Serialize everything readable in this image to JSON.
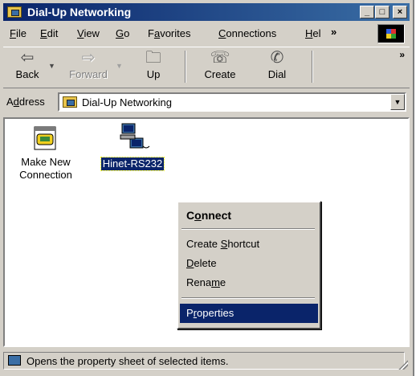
{
  "window": {
    "title": "Dial-Up Networking",
    "controls": {
      "minimize": "_",
      "maximize": "□",
      "close": "×"
    }
  },
  "menu": {
    "items": [
      {
        "label": "File",
        "key": "F",
        "rest": "ile"
      },
      {
        "label": "Edit",
        "key": "E",
        "rest": "dit"
      },
      {
        "label": "View",
        "key": "V",
        "rest": "iew"
      },
      {
        "label": "Go",
        "key": "G",
        "rest": "o"
      },
      {
        "label": "Favorites",
        "pre": "F",
        "key": "a",
        "rest": "vorites"
      },
      {
        "label": "Connections",
        "key": "C",
        "rest": "onnections"
      },
      {
        "label": "Hel",
        "key": "H",
        "rest": "el"
      }
    ],
    "overflow": "»"
  },
  "toolbar": {
    "back": "Back",
    "forward": "Forward",
    "up": "Up",
    "create": "Create",
    "dial": "Dial",
    "overflow": "»"
  },
  "address": {
    "label_pre": "A",
    "label_key": "d",
    "label_rest": "dress",
    "value": "Dial-Up Networking"
  },
  "icons": [
    {
      "line1": "Make New",
      "line2": "Connection",
      "icon": "make-new-connection-icon"
    },
    {
      "line1": "Hinet-RS232",
      "icon": "dialup-connection-icon",
      "selected": true
    }
  ],
  "context_menu": {
    "connect": {
      "pre": "C",
      "key": "o",
      "rest": "nnect"
    },
    "create_shortcut": {
      "pre": "Create ",
      "key": "S",
      "rest": "hortcut"
    },
    "delete": {
      "pre": "",
      "key": "D",
      "rest": "elete"
    },
    "rename": {
      "pre": "Rena",
      "key": "m",
      "rest": "e"
    },
    "properties": {
      "pre": "P",
      "key": "r",
      "rest": "operties"
    }
  },
  "status": {
    "text": "Opens the property sheet of selected items."
  },
  "colors": {
    "title_bar": "#0a246a",
    "face": "#d4d0c8",
    "selection": "#0a246a"
  }
}
